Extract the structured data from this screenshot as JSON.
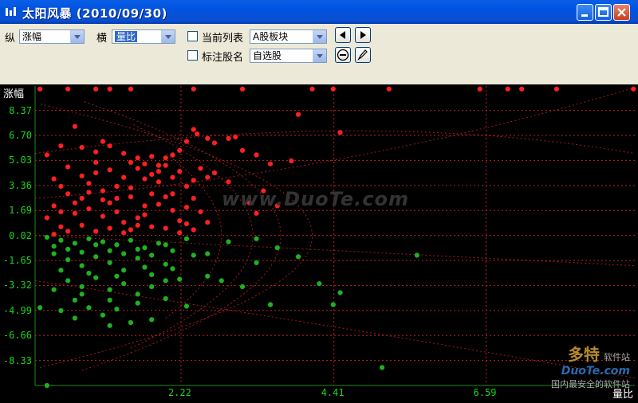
{
  "window": {
    "title": "太阳风暴 (2010/09/30)"
  },
  "toolbar": {
    "vert_label": "纵",
    "vert_value": "涨幅",
    "horiz_label": "横",
    "horiz_value": "量比",
    "current_list_label": "当前列表",
    "current_list_value": "A股板块",
    "mark_name_label": "标注股名",
    "mark_name_value": "自选股"
  },
  "watermark": {
    "center": "www.DuoTe.com",
    "brand": "多特",
    "brand_sub": "软件站",
    "domain": "DuoTe.com",
    "slogan": "国内最安全的软件站"
  },
  "colors": {
    "up": "#ff2020",
    "down": "#20b020",
    "grid": "#c02020",
    "tick": "#18d418"
  },
  "chart_data": {
    "type": "scatter",
    "ylabel": "涨幅",
    "xlabel": "量比",
    "yticks": [
      "8.37",
      "6.70",
      "5.03",
      "3.36",
      "1.69",
      "0.02",
      "-1.65",
      "-3.32",
      "-4.99",
      "-6.66",
      "-8.33"
    ],
    "xticks": [
      "2.22",
      "4.41",
      "6.59"
    ],
    "xlim": [
      0.13,
      8.72
    ],
    "ylim": [
      -10.0,
      10.0
    ],
    "series": [
      {
        "color": "#ff2020",
        "points": [
          [
            0.3,
            5.4
          ],
          [
            0.5,
            6.0
          ],
          [
            0.7,
            7.3
          ],
          [
            0.8,
            5.9
          ],
          [
            1.0,
            5.6
          ],
          [
            1.1,
            6.3
          ],
          [
            1.2,
            6.0
          ],
          [
            1.4,
            5.5
          ],
          [
            1.5,
            4.9
          ],
          [
            1.6,
            5.2
          ],
          [
            1.7,
            4.8
          ],
          [
            1.8,
            5.3
          ],
          [
            1.9,
            4.7
          ],
          [
            2.0,
            5.2
          ],
          [
            2.1,
            5.4
          ],
          [
            2.2,
            5.7
          ],
          [
            2.3,
            6.3
          ],
          [
            2.4,
            7.1
          ],
          [
            2.45,
            6.8
          ],
          [
            2.6,
            6.5
          ],
          [
            2.7,
            6.2
          ],
          [
            2.9,
            6.5
          ],
          [
            3.0,
            6.6
          ],
          [
            3.1,
            5.7
          ],
          [
            3.3,
            5.4
          ],
          [
            3.5,
            4.8
          ],
          [
            3.8,
            5.0
          ],
          [
            2.5,
            4.5
          ],
          [
            2.6,
            3.9
          ],
          [
            2.7,
            4.2
          ],
          [
            2.9,
            3.6
          ],
          [
            3.2,
            2.2
          ],
          [
            3.3,
            1.5
          ],
          [
            3.4,
            3.0
          ],
          [
            3.6,
            2.0
          ],
          [
            4.5,
            6.9
          ],
          [
            3.9,
            8.1
          ],
          [
            0.4,
            3.8
          ],
          [
            0.5,
            3.3
          ],
          [
            0.6,
            2.8
          ],
          [
            0.4,
            2.0
          ],
          [
            0.3,
            1.2
          ],
          [
            0.5,
            0.6
          ],
          [
            0.6,
            0.3
          ],
          [
            0.4,
            0.1
          ],
          [
            0.7,
            1.5
          ],
          [
            0.8,
            2.5
          ],
          [
            0.9,
            3.5
          ],
          [
            1.0,
            4.2
          ],
          [
            1.1,
            3.0
          ],
          [
            1.2,
            2.2
          ],
          [
            1.3,
            1.6
          ],
          [
            1.4,
            0.9
          ],
          [
            1.5,
            0.4
          ],
          [
            1.6,
            1.2
          ],
          [
            1.7,
            2.0
          ],
          [
            1.8,
            2.8
          ],
          [
            1.9,
            3.6
          ],
          [
            2.0,
            2.6
          ],
          [
            2.1,
            1.7
          ],
          [
            2.2,
            1.0
          ],
          [
            2.3,
            0.8
          ],
          [
            2.0,
            0.5
          ],
          [
            1.8,
            0.6
          ],
          [
            1.6,
            0.7
          ],
          [
            1.4,
            0.2
          ],
          [
            1.2,
            0.5
          ],
          [
            1.0,
            0.3
          ],
          [
            0.8,
            0.7
          ],
          [
            0.9,
            1.8
          ],
          [
            1.1,
            1.3
          ],
          [
            1.3,
            2.5
          ],
          [
            1.5,
            3.2
          ],
          [
            1.7,
            3.8
          ],
          [
            1.9,
            4.3
          ],
          [
            2.1,
            3.9
          ],
          [
            2.3,
            3.3
          ],
          [
            2.4,
            2.5
          ],
          [
            2.5,
            1.6
          ],
          [
            2.6,
            0.9
          ],
          [
            2.4,
            0.4
          ],
          [
            2.2,
            0.2
          ],
          [
            0.6,
            4.6
          ],
          [
            0.8,
            4.0
          ],
          [
            1.0,
            4.9
          ],
          [
            1.2,
            4.4
          ],
          [
            1.4,
            3.9
          ],
          [
            1.6,
            4.5
          ],
          [
            1.8,
            4.1
          ],
          [
            2.0,
            4.7
          ],
          [
            2.2,
            4.3
          ],
          [
            2.4,
            3.7
          ],
          [
            0.5,
            1.6
          ],
          [
            0.7,
            2.2
          ],
          [
            0.9,
            2.9
          ],
          [
            1.1,
            2.4
          ],
          [
            1.3,
            3.3
          ],
          [
            1.5,
            2.6
          ],
          [
            1.7,
            1.4
          ],
          [
            1.9,
            2.1
          ],
          [
            2.1,
            2.8
          ],
          [
            2.3,
            1.9
          ],
          [
            0.2,
            9.8
          ],
          [
            0.6,
            9.8
          ],
          [
            1.0,
            9.8
          ],
          [
            1.2,
            9.8
          ],
          [
            1.5,
            9.8
          ],
          [
            2.4,
            9.8
          ],
          [
            3.1,
            9.8
          ],
          [
            4.1,
            9.8
          ],
          [
            4.4,
            9.8
          ],
          [
            5.2,
            9.8
          ],
          [
            6.5,
            9.8
          ],
          [
            6.9,
            9.8
          ],
          [
            7.1,
            9.8
          ],
          [
            7.6,
            9.8
          ],
          [
            8.7,
            9.8
          ]
        ]
      },
      {
        "color": "#20b020",
        "points": [
          [
            0.3,
            -0.1
          ],
          [
            0.5,
            -0.3
          ],
          [
            0.7,
            -0.5
          ],
          [
            0.9,
            -0.2
          ],
          [
            1.1,
            -0.4
          ],
          [
            1.3,
            -0.6
          ],
          [
            1.5,
            -0.3
          ],
          [
            1.7,
            -0.8
          ],
          [
            1.9,
            -0.5
          ],
          [
            2.1,
            -1.0
          ],
          [
            2.3,
            -0.2
          ],
          [
            0.4,
            -1.2
          ],
          [
            0.6,
            -1.6
          ],
          [
            0.8,
            -2.0
          ],
          [
            1.0,
            -1.4
          ],
          [
            1.2,
            -1.8
          ],
          [
            1.4,
            -2.3
          ],
          [
            1.6,
            -1.5
          ],
          [
            1.8,
            -2.6
          ],
          [
            2.0,
            -1.9
          ],
          [
            2.2,
            -2.9
          ],
          [
            2.4,
            -1.3
          ],
          [
            0.6,
            -3.0
          ],
          [
            0.8,
            -3.4
          ],
          [
            1.0,
            -2.8
          ],
          [
            1.2,
            -3.6
          ],
          [
            1.4,
            -3.2
          ],
          [
            1.6,
            -3.9
          ],
          [
            1.8,
            -3.4
          ],
          [
            2.0,
            -4.2
          ],
          [
            0.7,
            -4.3
          ],
          [
            0.9,
            -4.8
          ],
          [
            1.1,
            -5.3
          ],
          [
            1.3,
            -4.9
          ],
          [
            1.5,
            -5.8
          ],
          [
            0.5,
            -5.0
          ],
          [
            0.7,
            -5.5
          ],
          [
            1.2,
            -6.0
          ],
          [
            2.3,
            -4.7
          ],
          [
            1.8,
            -5.6
          ],
          [
            3.1,
            -3.4
          ],
          [
            3.3,
            -1.8
          ],
          [
            3.6,
            -0.8
          ],
          [
            3.9,
            -1.4
          ],
          [
            4.2,
            -3.2
          ],
          [
            4.5,
            -3.8
          ],
          [
            4.4,
            -4.6
          ],
          [
            3.5,
            -4.6
          ],
          [
            2.9,
            -0.4
          ],
          [
            2.6,
            -1.2
          ],
          [
            0.2,
            -4.8
          ],
          [
            5.6,
            -1.3
          ],
          [
            5.1,
            -8.8
          ],
          [
            0.3,
            -10.0
          ],
          [
            0.4,
            -0.7
          ],
          [
            0.6,
            -0.9
          ],
          [
            0.8,
            -1.1
          ],
          [
            1.0,
            -0.6
          ],
          [
            1.2,
            -1.0
          ],
          [
            1.4,
            -1.2
          ],
          [
            1.6,
            -0.9
          ],
          [
            1.8,
            -1.3
          ],
          [
            2.0,
            -0.6
          ],
          [
            0.5,
            -2.3
          ],
          [
            0.9,
            -2.5
          ],
          [
            1.3,
            -2.7
          ],
          [
            1.7,
            -2.1
          ],
          [
            2.1,
            -2.2
          ],
          [
            0.4,
            -3.6
          ],
          [
            0.8,
            -3.9
          ],
          [
            1.2,
            -4.3
          ],
          [
            1.6,
            -4.5
          ],
          [
            2.0,
            -3.0
          ],
          [
            2.6,
            -2.7
          ],
          [
            2.8,
            -3.0
          ],
          [
            3.3,
            -0.2
          ]
        ]
      }
    ]
  }
}
